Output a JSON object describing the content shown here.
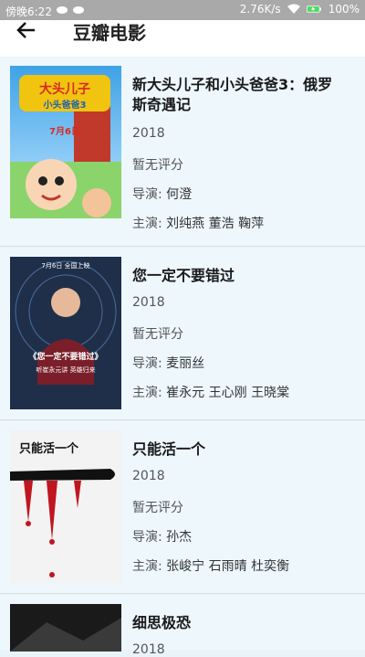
{
  "status_bar": {
    "time": "傍晚6:22",
    "speed": "2.76K/s",
    "battery": "100%"
  },
  "app_bar": {
    "back_icon": "back-arrow-icon",
    "title": "豆瓣电影"
  },
  "labels": {
    "director": "导演: ",
    "cast": "主演: "
  },
  "movies": [
    {
      "title": "新大头儿子和小头爸爸3：俄罗斯奇遇记",
      "year": "2018",
      "rating": "暂无评分",
      "director": "何澄",
      "cast": "刘纯燕 董浩 鞠萍",
      "poster_text": "大头儿子",
      "poster_sub": "小头爸爸3",
      "poster_date": "7月6日"
    },
    {
      "title": "您一定不要错过",
      "year": "2018",
      "rating": "暂无评分",
      "director": "麦丽丝",
      "cast": "崔永元 王心刚 王晓棠",
      "poster_top": "7月6日 全国上映",
      "poster_text": "《您一定不要错过》",
      "poster_sub": "听崔永元讲 英雄归来"
    },
    {
      "title": "只能活一个",
      "year": "2018",
      "rating": "暂无评分",
      "director": "孙杰",
      "cast": "张峻宁 石雨晴 杜奕衡",
      "poster_text": "只能活一个"
    },
    {
      "title": "细思极恐",
      "year": "2018"
    }
  ]
}
